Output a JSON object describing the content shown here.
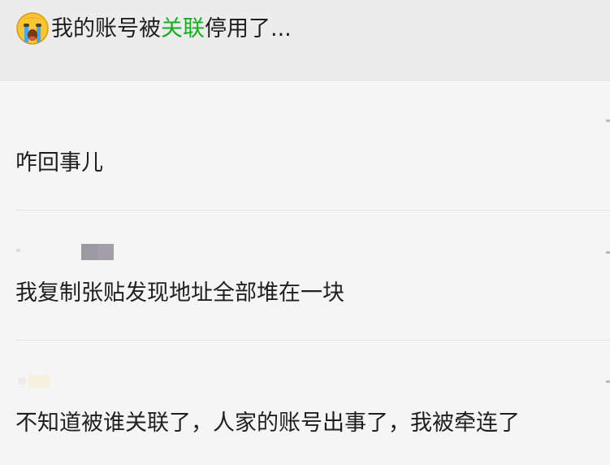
{
  "header": {
    "emoji_icon": "crying-face-icon",
    "title_prefix": "我的账号被",
    "title_highlight": "关联",
    "title_suffix": "停用了...",
    "highlight_color": "#14b01f"
  },
  "posts": [
    {
      "text": "咋回事儿"
    },
    {
      "text": "我复制张贴发现地址全部堆在一块"
    },
    {
      "text": "不知道被谁关联了，人家的账号出事了，我被牵连了"
    }
  ]
}
